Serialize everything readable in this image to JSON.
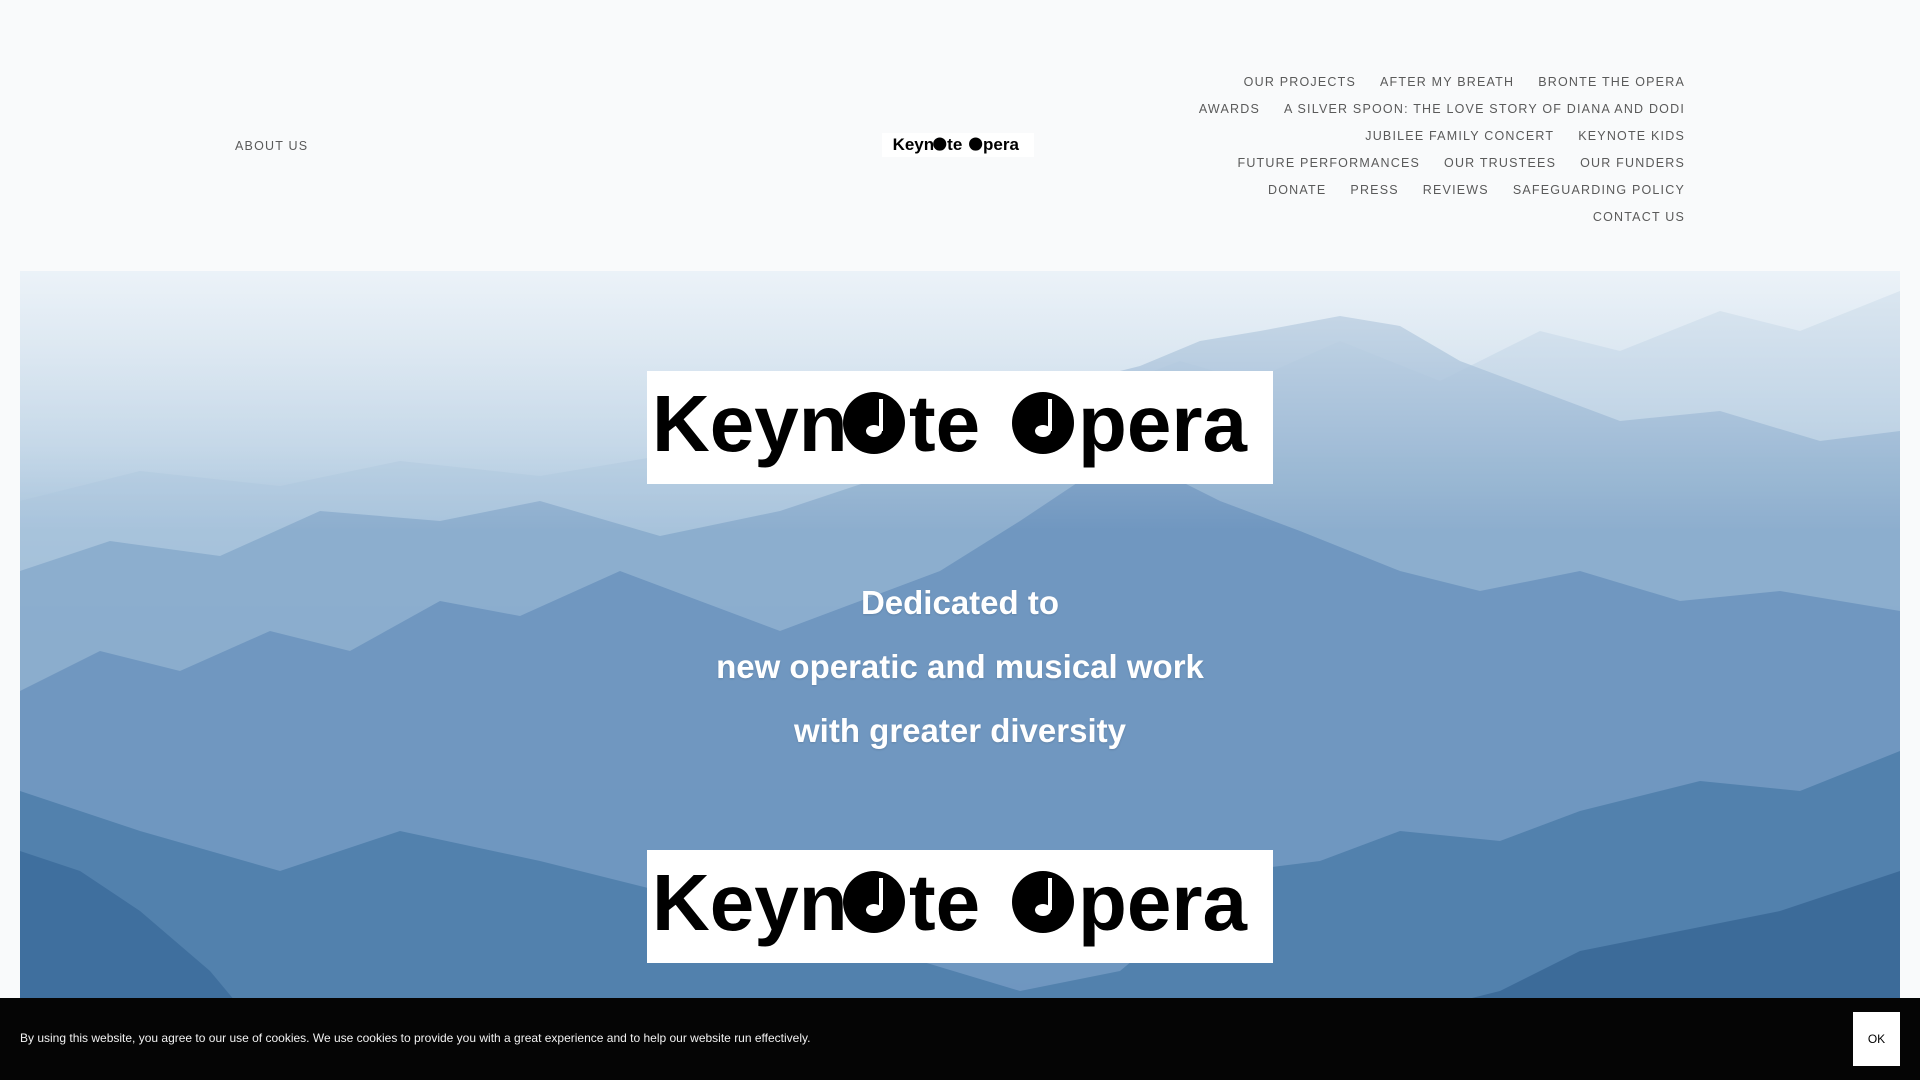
{
  "header": {
    "about_label": "ABOUT US",
    "logo_text": "Keynote Opera",
    "nav_rows": [
      [
        "OUR PROJECTS",
        "AFTER MY BREATH",
        "BRONTE THE OPERA"
      ],
      [
        "AWARDS",
        "A SILVER SPOON: THE LOVE STORY OF DIANA AND DODI"
      ],
      [
        "JUBILEE FAMILY CONCERT",
        "KEYNOTE KIDS"
      ],
      [
        "FUTURE PERFORMANCES",
        "OUR TRUSTEES",
        "OUR FUNDERS"
      ],
      [
        "DONATE",
        "PRESS",
        "REVIEWS",
        "SAFEGUARDING POLICY"
      ],
      [
        "CONTACT US"
      ]
    ]
  },
  "hero": {
    "logo_text": "Keynote Opera",
    "tagline": [
      "Dedicated to",
      "new operatic and musical work",
      "with greater diversity"
    ]
  },
  "cookie": {
    "text": "By using this website, you agree to our use of cookies. We use cookies to provide you with a great experience and to help our website run effectively.",
    "ok_label": "OK"
  },
  "icons": {
    "logo_note": "music-note-icon"
  },
  "colors": {
    "background": "#f9fafb",
    "nav_text": "#5a5a5a",
    "cookie_bg": "#050505"
  }
}
